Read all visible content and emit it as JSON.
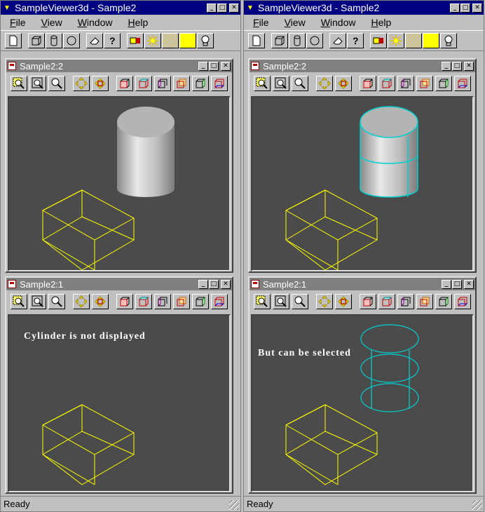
{
  "colors": {
    "titlebar": "#000080",
    "viewport_bg": "#4b4b4b",
    "wire_box": "#ffff00",
    "selected": "#00c8c8"
  },
  "apps": [
    {
      "title": "SampleViewer3d - Sample2",
      "menu": [
        "File",
        "View",
        "Window",
        "Help"
      ],
      "children": [
        {
          "title": "Sample2:2",
          "overlay_text": ""
        },
        {
          "title": "Sample2:1",
          "overlay_text": "Cylinder is not displayed"
        }
      ],
      "status": "Ready"
    },
    {
      "title": "SampleViewer3d - Sample2",
      "menu": [
        "File",
        "View",
        "Window",
        "Help"
      ],
      "children": [
        {
          "title": "Sample2:2",
          "overlay_text": ""
        },
        {
          "title": "Sample2:1",
          "overlay_text": "But can be selected"
        }
      ],
      "status": "Ready"
    }
  ],
  "toolbar_icons": [
    "new-icon",
    "box-icon",
    "cylinder-icon",
    "sphere-icon",
    "eraser-icon",
    "help-icon",
    "material-icon",
    "light-icon",
    "texture-icon",
    "color-icon",
    "bulb-icon"
  ],
  "view_icons": [
    "zoom-window-icon",
    "zoom-fit-icon",
    "zoom-icon",
    "pan-icon",
    "global-pan-icon",
    "front-view-icon",
    "top-view-icon",
    "left-view-icon",
    "back-view-icon",
    "right-view-icon",
    "bottom-view-icon"
  ]
}
